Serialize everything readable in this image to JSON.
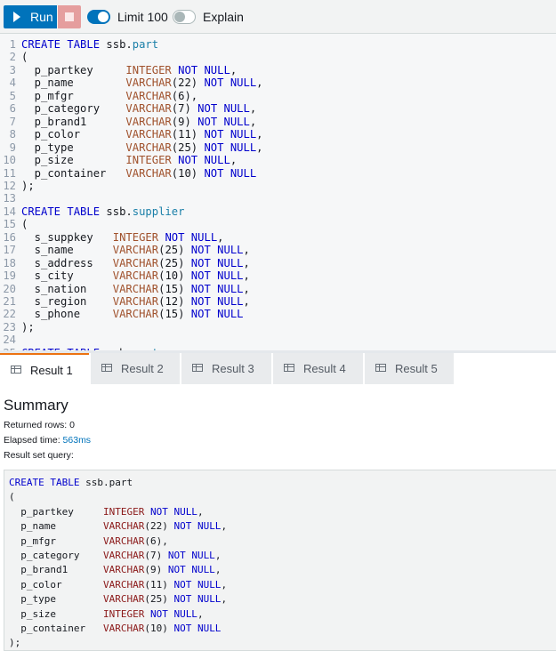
{
  "toolbar": {
    "run_label": "Run",
    "limit_label": "Limit 100",
    "explain_label": "Explain",
    "limit_enabled": true,
    "explain_enabled": false,
    "run_color": "#0073bb"
  },
  "editor": {
    "lines": [
      {
        "n": "1",
        "t": "CREATE TABLE ssb.part"
      },
      {
        "n": "2",
        "t": "("
      },
      {
        "n": "3",
        "t": "  p_partkey     INTEGER NOT NULL,"
      },
      {
        "n": "4",
        "t": "  p_name        VARCHAR(22) NOT NULL,"
      },
      {
        "n": "5",
        "t": "  p_mfgr        VARCHAR(6),"
      },
      {
        "n": "6",
        "t": "  p_category    VARCHAR(7) NOT NULL,"
      },
      {
        "n": "7",
        "t": "  p_brand1      VARCHAR(9) NOT NULL,"
      },
      {
        "n": "8",
        "t": "  p_color       VARCHAR(11) NOT NULL,"
      },
      {
        "n": "9",
        "t": "  p_type        VARCHAR(25) NOT NULL,"
      },
      {
        "n": "10",
        "t": "  p_size        INTEGER NOT NULL,"
      },
      {
        "n": "11",
        "t": "  p_container   VARCHAR(10) NOT NULL"
      },
      {
        "n": "12",
        "t": ");"
      },
      {
        "n": "13",
        "t": ""
      },
      {
        "n": "14",
        "t": "CREATE TABLE ssb.supplier"
      },
      {
        "n": "15",
        "t": "("
      },
      {
        "n": "16",
        "t": "  s_suppkey   INTEGER NOT NULL,"
      },
      {
        "n": "17",
        "t": "  s_name      VARCHAR(25) NOT NULL,"
      },
      {
        "n": "18",
        "t": "  s_address   VARCHAR(25) NOT NULL,"
      },
      {
        "n": "19",
        "t": "  s_city      VARCHAR(10) NOT NULL,"
      },
      {
        "n": "20",
        "t": "  s_nation    VARCHAR(15) NOT NULL,"
      },
      {
        "n": "21",
        "t": "  s_region    VARCHAR(12) NOT NULL,"
      },
      {
        "n": "22",
        "t": "  s_phone     VARCHAR(15) NOT NULL"
      },
      {
        "n": "23",
        "t": ");"
      },
      {
        "n": "24",
        "t": ""
      },
      {
        "n": "25",
        "t": "CREATE TABLE ssb.customer"
      }
    ]
  },
  "tabs": [
    {
      "label": "Result 1",
      "active": true
    },
    {
      "label": "Result 2",
      "active": false
    },
    {
      "label": "Result 3",
      "active": false
    },
    {
      "label": "Result 4",
      "active": false
    },
    {
      "label": "Result 5",
      "active": false
    }
  ],
  "summary": {
    "title": "Summary",
    "returned_rows_label": "Returned rows: ",
    "returned_rows": "0",
    "elapsed_label": "Elapsed time: ",
    "elapsed": "563ms",
    "query_label": "Result set query:"
  },
  "query": {
    "lines": [
      "CREATE TABLE ssb.part",
      "(",
      "  p_partkey     INTEGER NOT NULL,",
      "  p_name        VARCHAR(22) NOT NULL,",
      "  p_mfgr        VARCHAR(6),",
      "  p_category    VARCHAR(7) NOT NULL,",
      "  p_brand1      VARCHAR(9) NOT NULL,",
      "  p_color       VARCHAR(11) NOT NULL,",
      "  p_type        VARCHAR(25) NOT NULL,",
      "  p_size        INTEGER NOT NULL,",
      "  p_container   VARCHAR(10) NOT NULL",
      ");"
    ]
  }
}
